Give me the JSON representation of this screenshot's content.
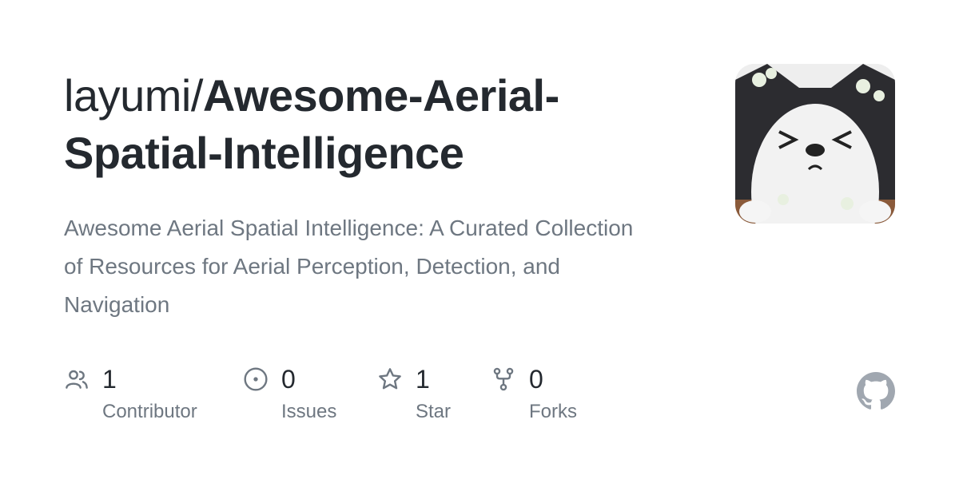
{
  "repo": {
    "owner": "layumi/",
    "name_line1": "Awesome-Aerial-",
    "name_line2": "Spatial-Intelligence",
    "description": "Awesome Aerial Spatial Intelligence: A Curated Collection of Resources for Aerial Perception, Detection, and Navigation"
  },
  "stats": [
    {
      "icon": "people-icon",
      "value": "1",
      "label": "Contributor"
    },
    {
      "icon": "issue-icon",
      "value": "0",
      "label": "Issues"
    },
    {
      "icon": "star-icon",
      "value": "1",
      "label": "Star"
    },
    {
      "icon": "fork-icon",
      "value": "0",
      "label": "Forks"
    }
  ],
  "avatar": {
    "icon": "avatar-image"
  },
  "brand": {
    "icon": "github-mark-icon",
    "color": "#a0a7b0"
  },
  "colors": {
    "title": "#24292f",
    "muted": "#6e7781",
    "bottom_bar": [
      "#34d058",
      "#9c56f0",
      "#f1e05a",
      "#e34c26",
      "#3572a5"
    ]
  }
}
